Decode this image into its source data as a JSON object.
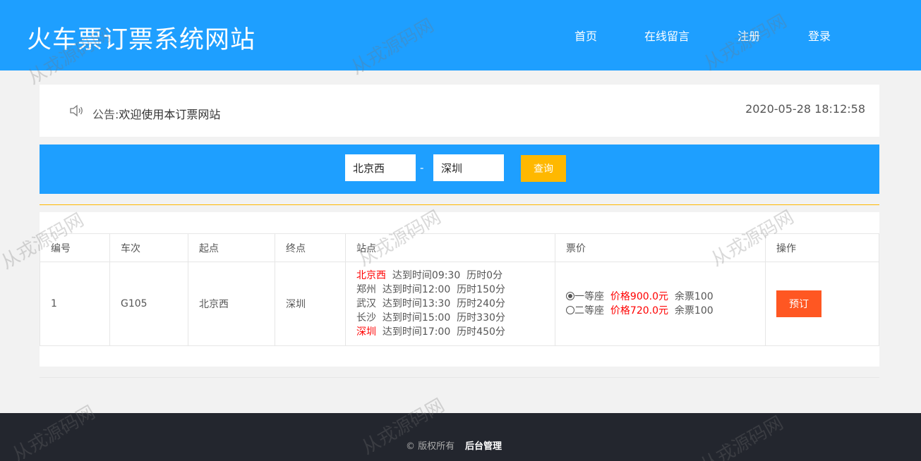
{
  "header": {
    "title": "火车票订票系统网站",
    "nav": [
      "首页",
      "在线留言",
      "注册",
      "登录"
    ]
  },
  "notice": {
    "label": "公告:",
    "text": "欢迎使用本订票网站",
    "datetime": "2020-05-28 18:12:58",
    "icon": "speaker-icon"
  },
  "search": {
    "from_value": "北京西",
    "to_value": "深圳",
    "separator": "-",
    "query_label": "查询"
  },
  "table": {
    "headers": [
      "编号",
      "车次",
      "起点",
      "终点",
      "站点",
      "票价",
      "操作"
    ],
    "rows": [
      {
        "id": "1",
        "train": "G105",
        "origin": "北京西",
        "destination": "深圳",
        "stations": [
          {
            "name": "北京西",
            "arrive": "达到时间09:30",
            "duration": "历时0分",
            "highlight": true
          },
          {
            "name": "郑州",
            "arrive": "达到时间12:00",
            "duration": "历时150分",
            "highlight": false
          },
          {
            "name": "武汉",
            "arrive": "达到时间13:30",
            "duration": "历时240分",
            "highlight": false
          },
          {
            "name": "长沙",
            "arrive": "达到时间15:00",
            "duration": "历时330分",
            "highlight": false
          },
          {
            "name": "深圳",
            "arrive": "达到时间17:00",
            "duration": "历时450分",
            "highlight": true
          }
        ],
        "prices": [
          {
            "seat": "一等座",
            "price": "价格900.0元",
            "remaining": "余票100",
            "selected": true
          },
          {
            "seat": "二等座",
            "price": "价格720.0元",
            "remaining": "余票100",
            "selected": false
          }
        ],
        "action": "预订"
      }
    ]
  },
  "footer": {
    "copyright": "© 版权所有",
    "admin_link": "后台管理"
  },
  "watermark": "从戎源码网",
  "colors": {
    "header_bg": "#1e9fff",
    "query_button": "#ffb800",
    "book_button": "#ff5722",
    "highlight_text": "#ff0000",
    "footer_bg": "#23262e"
  }
}
